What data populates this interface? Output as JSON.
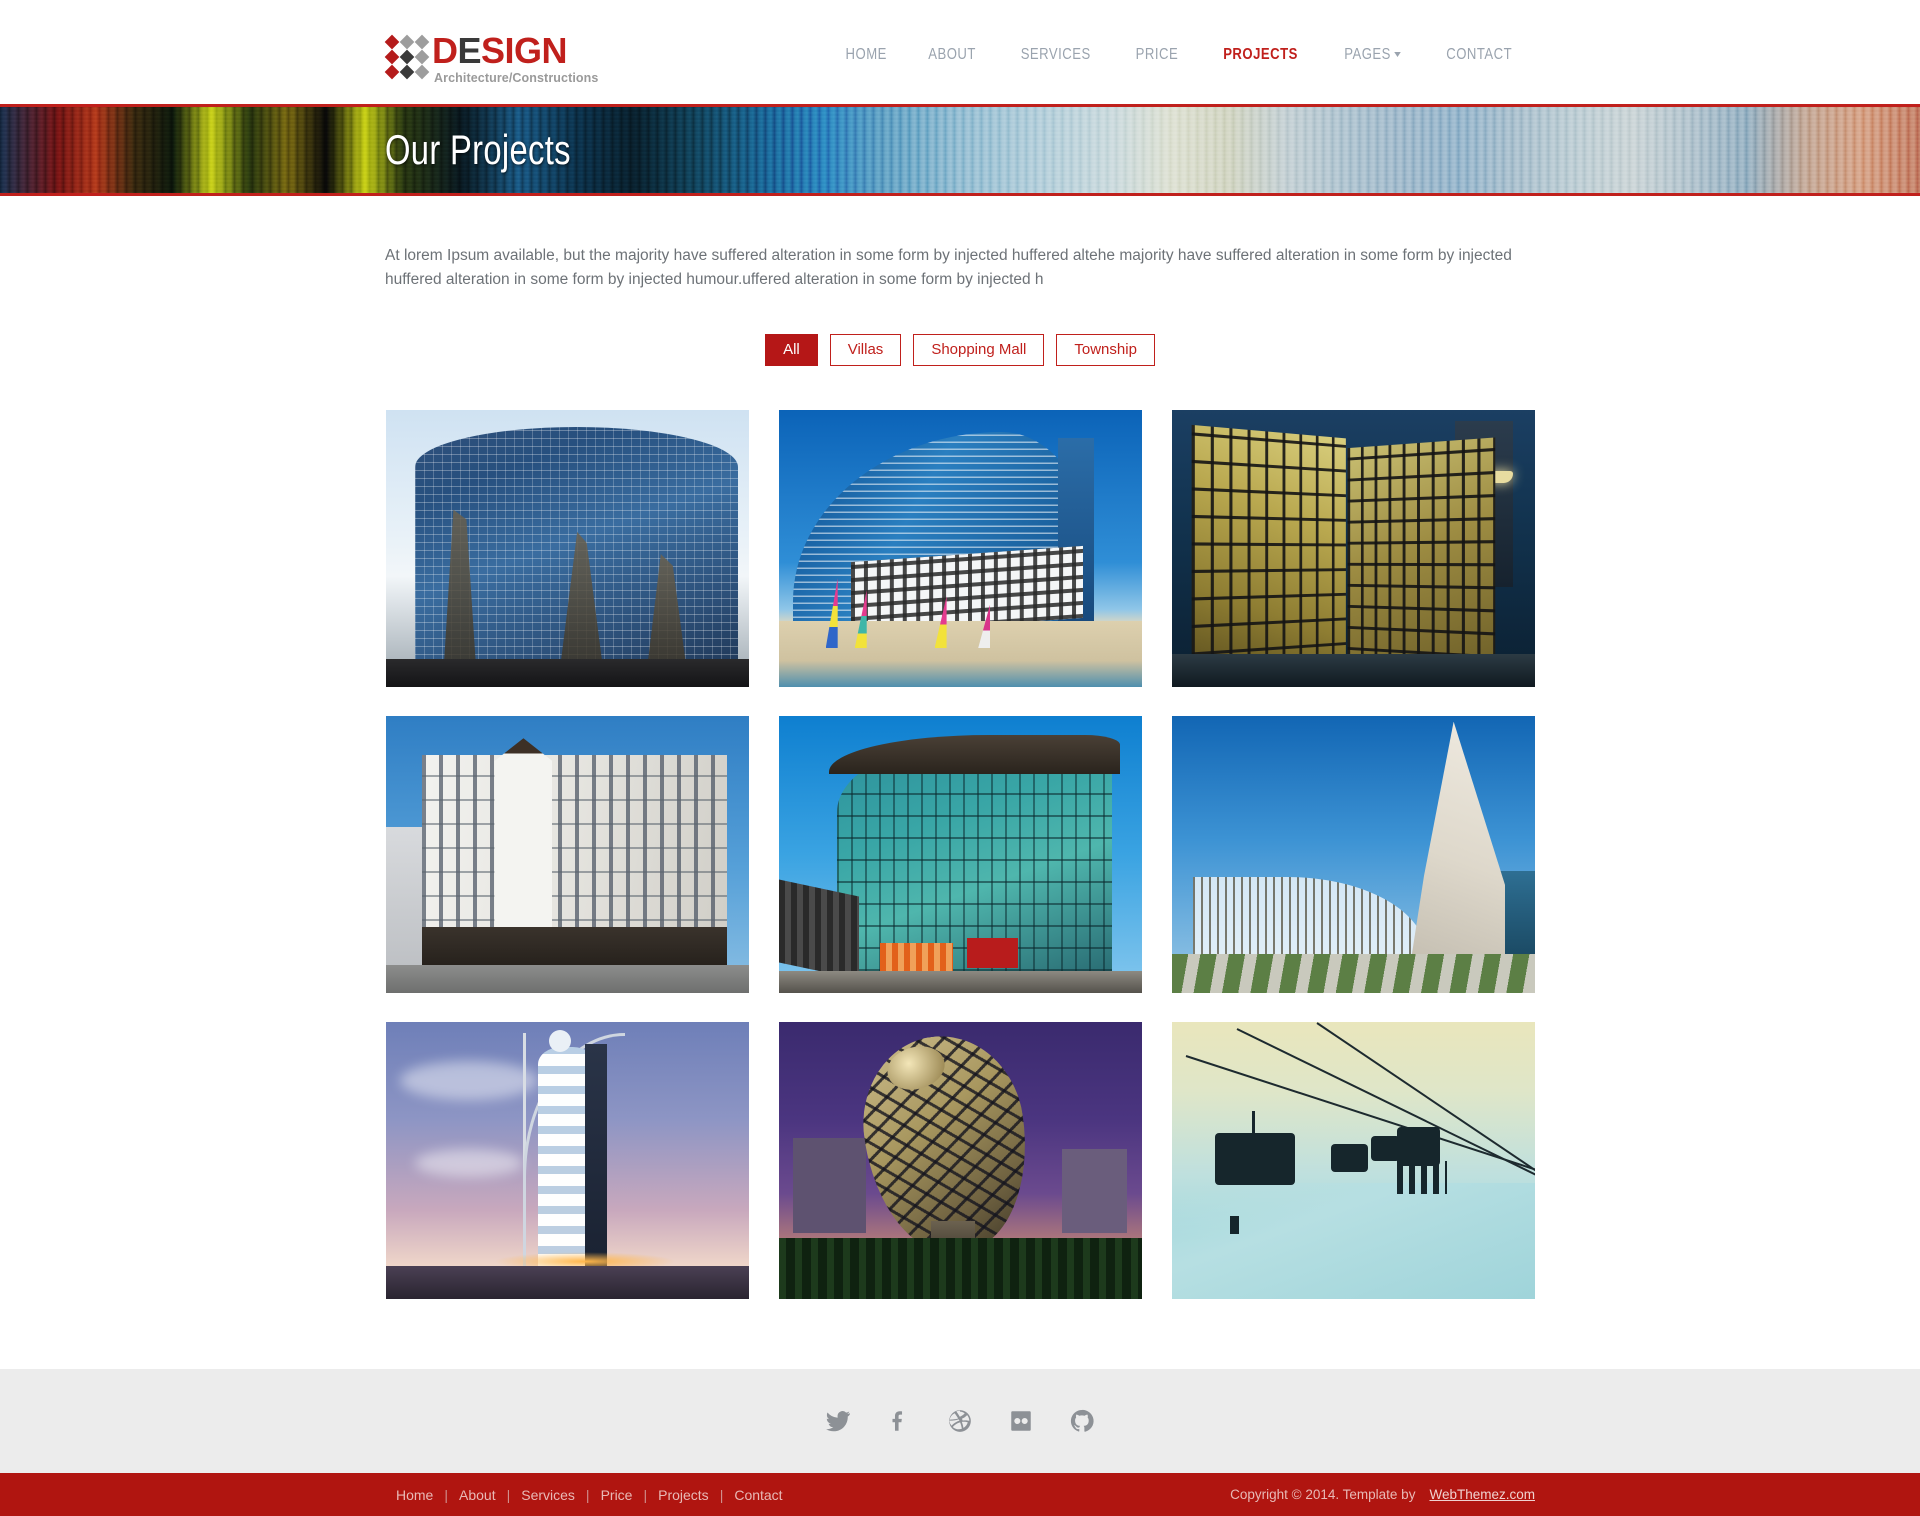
{
  "brand": {
    "name_part1": "D",
    "name_part2": "E",
    "name_part3": "SIGN",
    "tagline": "Architecture/Constructions",
    "accent_color": "#c0201c"
  },
  "nav": {
    "items": [
      {
        "label": "HOME",
        "active": false
      },
      {
        "label": "ABOUT",
        "active": false
      },
      {
        "label": "SERVICES",
        "active": false
      },
      {
        "label": "PRICE",
        "active": false
      },
      {
        "label": "PROJECTS",
        "active": true
      },
      {
        "label": "PAGES",
        "active": false,
        "has_dropdown": true
      },
      {
        "label": "CONTACT",
        "active": false
      }
    ]
  },
  "banner": {
    "title": "Our Projects"
  },
  "intro": {
    "text": "At lorem Ipsum available, but the majority have suffered alteration in some form by injected huffered altehe majority have suffered alteration in some form by injected huffered alteration in some form by injected humour.uffered alteration in some form by injected h"
  },
  "filters": {
    "items": [
      {
        "label": "All",
        "active": true
      },
      {
        "label": "Villas",
        "active": false
      },
      {
        "label": "Shopping Mall",
        "active": false
      },
      {
        "label": "Township",
        "active": false
      }
    ]
  },
  "projects": {
    "items": [
      {
        "art": "a1",
        "name": "curved-blue-glass-tower"
      },
      {
        "art": "a2",
        "name": "beach-hotel-with-sailboats"
      },
      {
        "art": "a3",
        "name": "illuminated-glass-office-dusk"
      },
      {
        "art": "a4",
        "name": "classical-white-corner-building"
      },
      {
        "art": "a5",
        "name": "curved-green-glass-building"
      },
      {
        "art": "a6",
        "name": "white-curved-modern-structure"
      },
      {
        "art": "a7",
        "name": "sail-shaped-luxury-hotel"
      },
      {
        "art": "a8",
        "name": "ovoid-glass-tower"
      },
      {
        "art": "a9",
        "name": "ski-lift-gondolas"
      }
    ]
  },
  "footer": {
    "social": [
      {
        "icon": "twitter-icon"
      },
      {
        "icon": "facebook-icon"
      },
      {
        "icon": "dribbble-icon"
      },
      {
        "icon": "flickr-icon"
      },
      {
        "icon": "github-icon"
      }
    ],
    "links": [
      {
        "label": "Home"
      },
      {
        "label": "About"
      },
      {
        "label": "Services"
      },
      {
        "label": "Price"
      },
      {
        "label": "Projects"
      },
      {
        "label": "Contact"
      }
    ],
    "separator": "|",
    "copyright": "Copyright © 2014. Template by",
    "brandname": "WebThemez.com",
    "bar_color": "#b01510"
  }
}
